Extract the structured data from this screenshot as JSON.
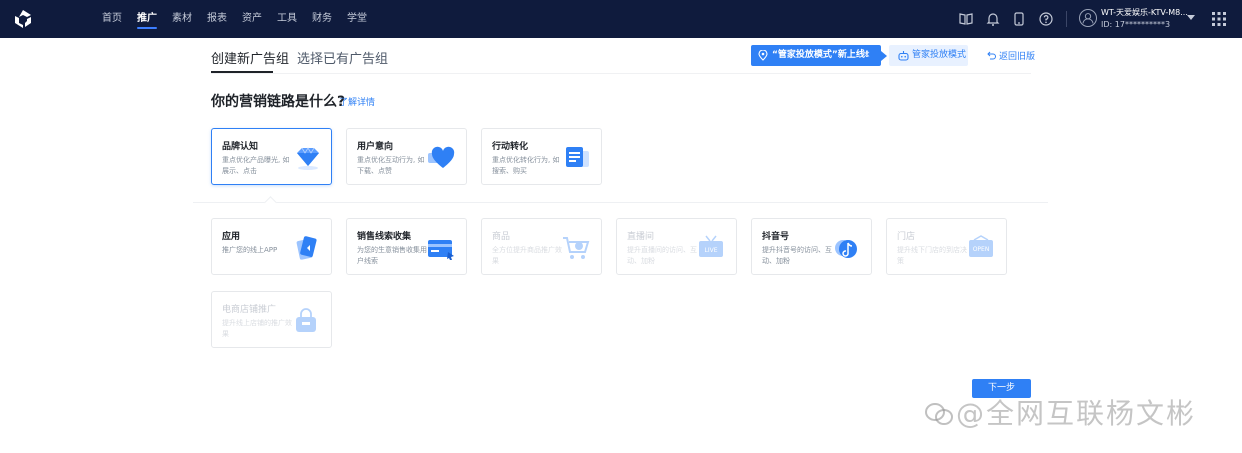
{
  "topbar": {
    "nav": [
      "首页",
      "推广",
      "素材",
      "报表",
      "资产",
      "工具",
      "财务",
      "学堂"
    ],
    "active_index": 1,
    "account_name": "WT-天爱娱乐-KTV-M8...",
    "account_id": "ID: 17**********3",
    "icons": [
      "book-icon",
      "bell-icon",
      "mobile-icon",
      "help-icon",
      "avatar",
      "apps-grid-icon"
    ]
  },
  "tabs": {
    "create_new": "创建新广告组",
    "choose_existing": "选择已有广告组"
  },
  "promo": {
    "text": "“管家投放模式”新上线!",
    "close": "×"
  },
  "steward_button": "管家投放模式",
  "back_old": "返回旧版",
  "question": "你的营销链路是什么?",
  "learn_more": "了解详情",
  "marketing_goals": [
    {
      "title": "品牌认知",
      "desc": "重点优化产品曝光, 如展示、点击",
      "icon": "diamond-icon",
      "selected": true
    },
    {
      "title": "用户意向",
      "desc": "重点优化互动行为, 如下载、点赞",
      "icon": "heart-icon",
      "selected": false
    },
    {
      "title": "行动转化",
      "desc": "重点优化转化行为, 如搜索、购买",
      "icon": "document-icon",
      "selected": false
    }
  ],
  "targets": [
    {
      "title": "应用",
      "desc": "推广您的线上APP",
      "icon": "app-icon",
      "disabled": false
    },
    {
      "title": "销售线索收集",
      "desc": "为您的生意销售收集用户线索",
      "icon": "lead-card-icon",
      "disabled": false
    },
    {
      "title": "商品",
      "desc": "全方位提升商品推广效果",
      "icon": "cart-icon",
      "disabled": true
    },
    {
      "title": "直播间",
      "desc": "提升直播间的访问、互动、加粉",
      "icon": "live-tv-icon",
      "disabled": true
    },
    {
      "title": "抖音号",
      "desc": "提升抖音号的访问、互动、加粉",
      "icon": "douyin-icon",
      "disabled": false
    },
    {
      "title": "门店",
      "desc": "提升线下门店的到店决策",
      "icon": "store-open-icon",
      "disabled": true
    },
    {
      "title": "电商店铺推广",
      "desc": "提升线上店铺的推广效果",
      "icon": "shop-bag-icon",
      "disabled": true
    }
  ],
  "next_button": "下一步",
  "watermark": "@全网互联杨文彬"
}
